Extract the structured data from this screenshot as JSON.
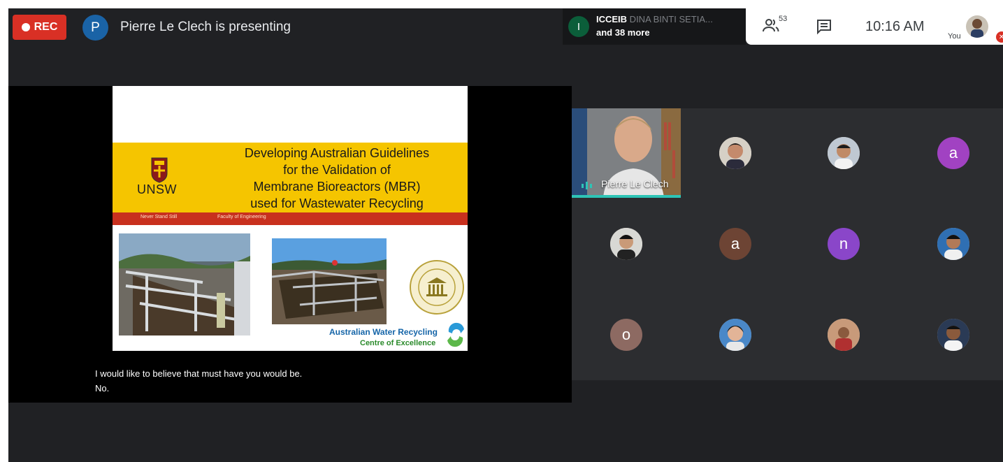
{
  "recording": {
    "label": "REC",
    "color": "#d93025"
  },
  "presenter": {
    "initial": "P",
    "status_text": "Pierre Le Clech is presenting"
  },
  "joined": {
    "initial": "I",
    "name_bold": "ICCEIB",
    "name_faded": " DINA BINTI SETIA...",
    "more": "and 38 more"
  },
  "toolbar": {
    "people_count": "53",
    "people_icon": "people-icon",
    "chat_icon": "chat-icon",
    "time": "10:16 AM",
    "you_label": "You"
  },
  "slide": {
    "title_lines": [
      "Developing Australian Guidelines",
      "for the Validation of",
      "Membrane Bioreactors (MBR)",
      "used for Wastewater Recycling"
    ],
    "logo_text": "UNSW",
    "band_left": "Never Stand Still",
    "band_right": "Faculty of Engineering",
    "footer_line1": "Australian Water Recycling",
    "footer_line2": "Centre of Excellence"
  },
  "captions": [
    "I would like to believe that must have you would be.",
    "No."
  ],
  "participants": {
    "video_tile": {
      "name": "Pierre Le Clech",
      "accent": "#2ec4b6"
    },
    "tiles": [
      {
        "kind": "photo"
      },
      {
        "kind": "photo"
      },
      {
        "kind": "initial",
        "initial": "a",
        "color": "#a142c2"
      },
      {
        "kind": "photo"
      },
      {
        "kind": "initial",
        "initial": "a",
        "color": "#6d4434"
      },
      {
        "kind": "initial",
        "initial": "n",
        "color": "#8a46c9"
      },
      {
        "kind": "photo"
      },
      {
        "kind": "initial",
        "initial": "o",
        "color": "#8d6a62"
      },
      {
        "kind": "photo"
      },
      {
        "kind": "photo"
      },
      {
        "kind": "photo"
      }
    ]
  }
}
